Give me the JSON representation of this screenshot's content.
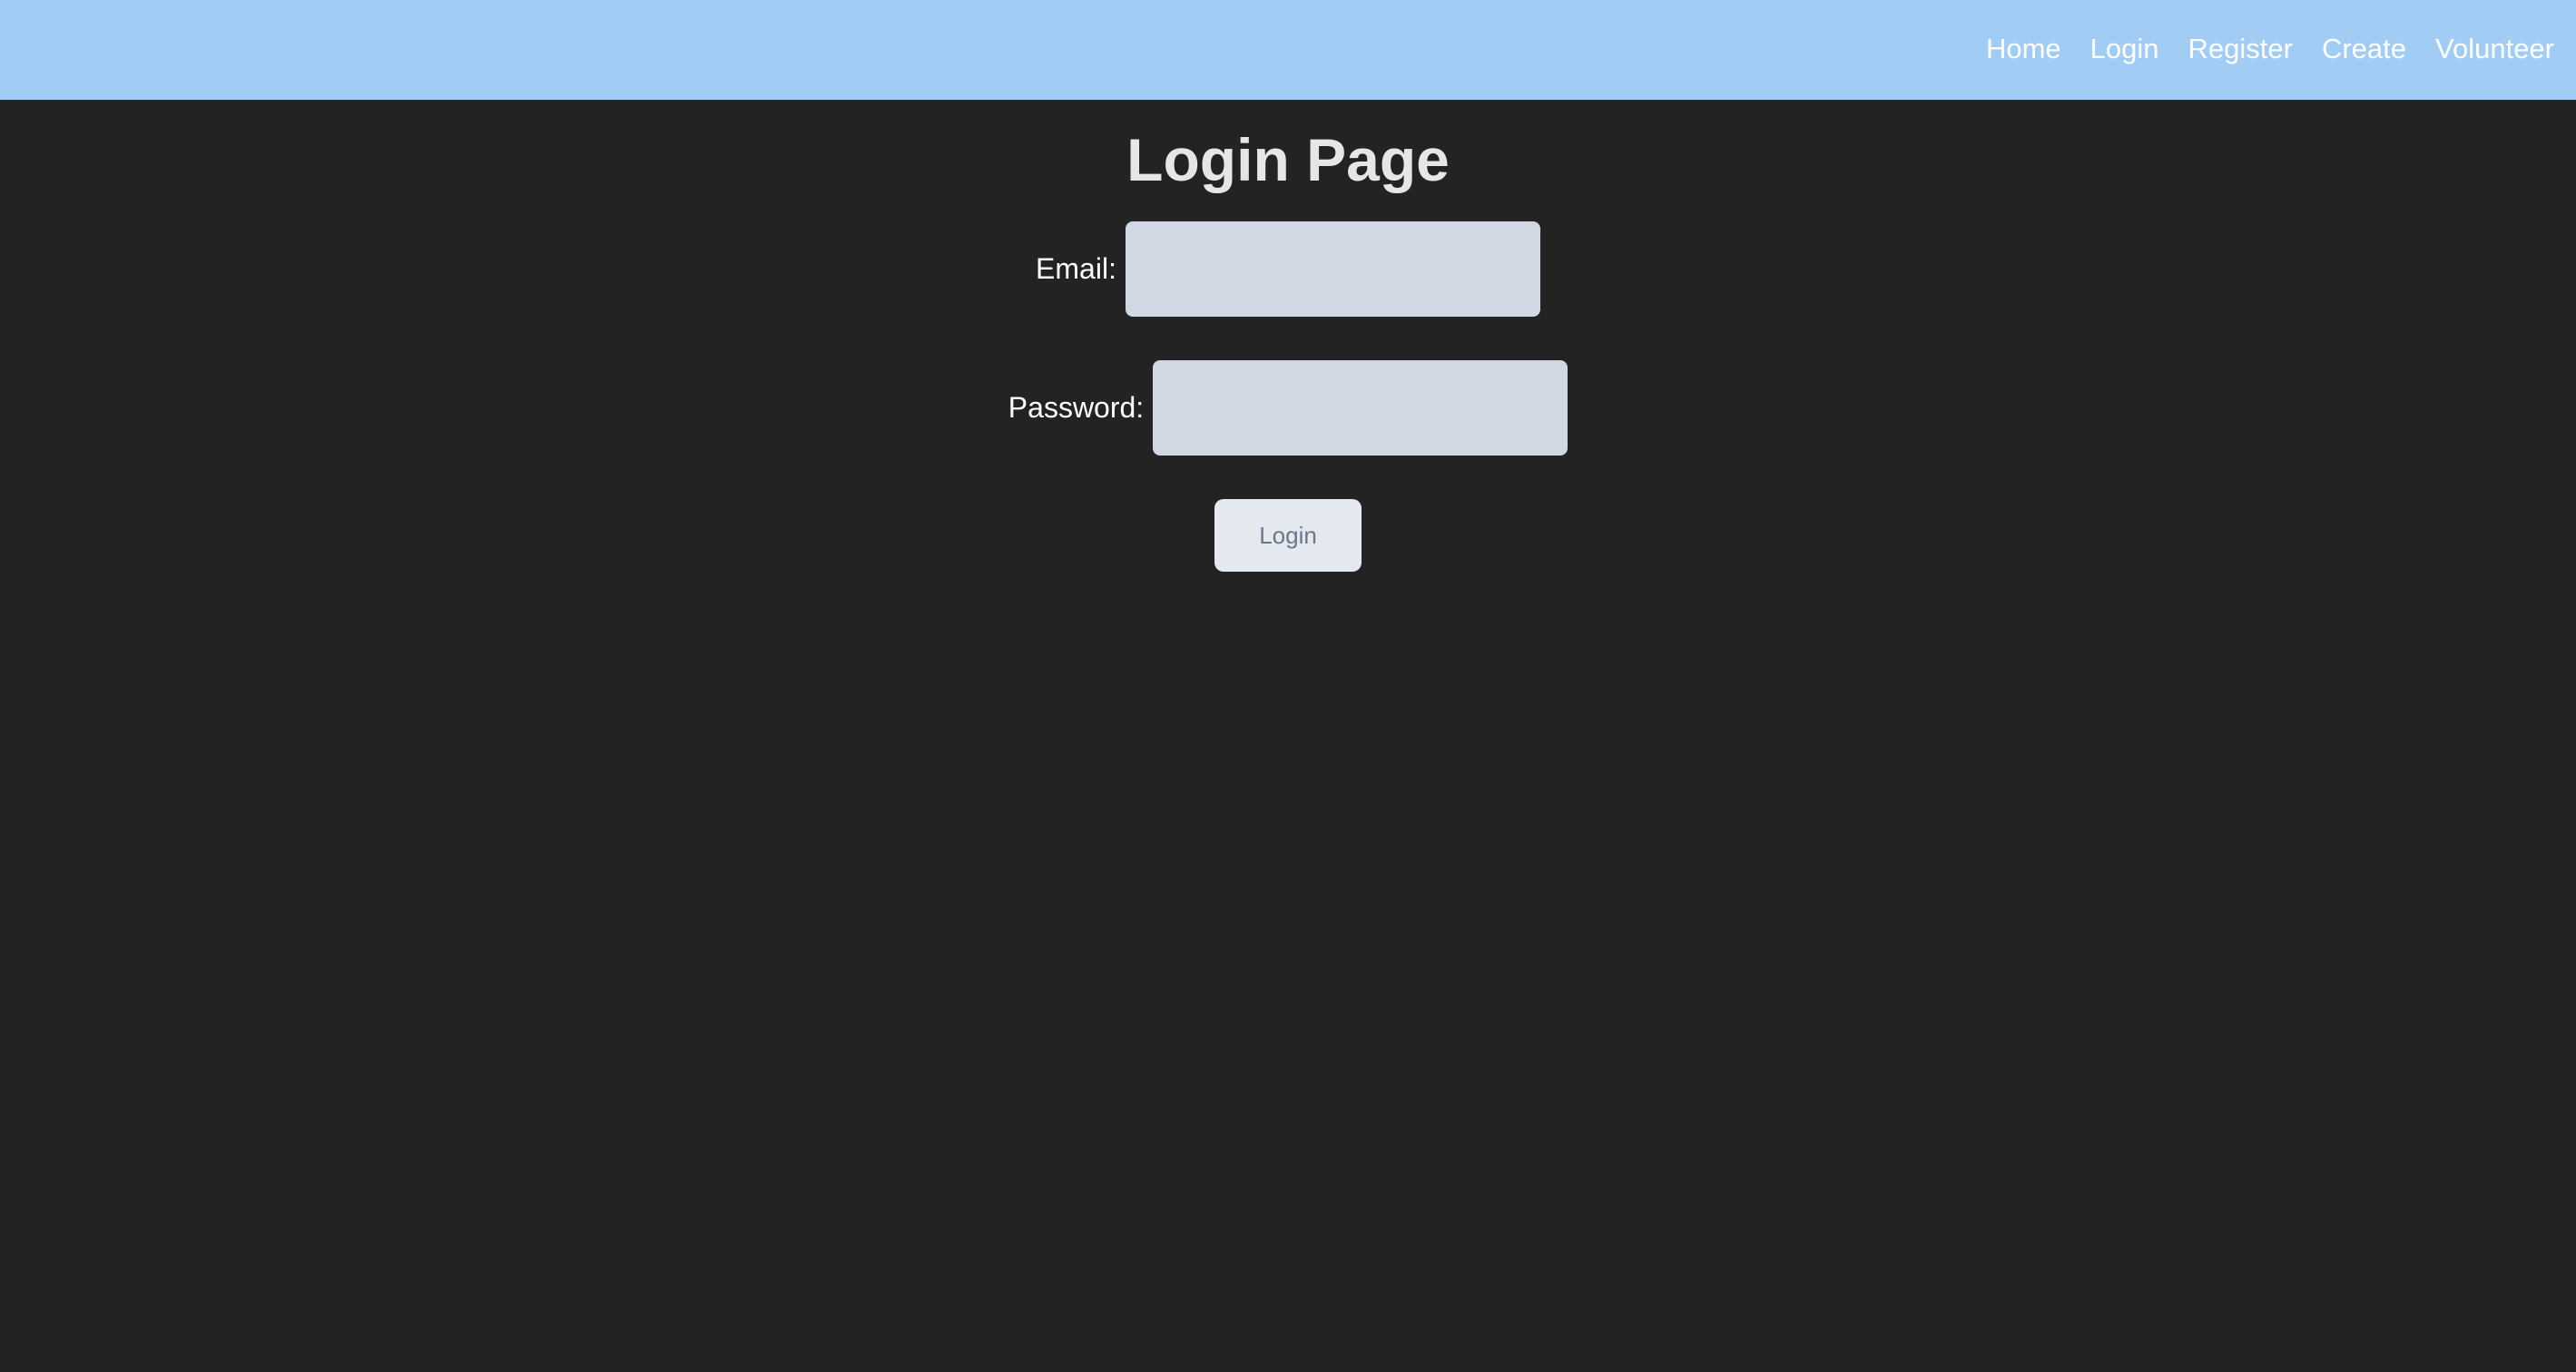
{
  "nav": {
    "items": [
      {
        "label": "Home"
      },
      {
        "label": "Login"
      },
      {
        "label": "Register"
      },
      {
        "label": "Create"
      },
      {
        "label": "Volunteer"
      }
    ]
  },
  "page": {
    "title": "Login Page"
  },
  "form": {
    "email": {
      "label": "Email:",
      "value": "",
      "placeholder": ""
    },
    "password": {
      "label": "Password:",
      "value": "",
      "placeholder": ""
    },
    "submit_label": "Login"
  },
  "colors": {
    "navbar_background": "#a1cdf5",
    "page_background": "#232323",
    "input_background": "#d1d7e3",
    "button_background": "#e4e8ef",
    "button_text": "#70768a",
    "title_text": "#e6e6e6",
    "nav_text": "#ffffff"
  }
}
